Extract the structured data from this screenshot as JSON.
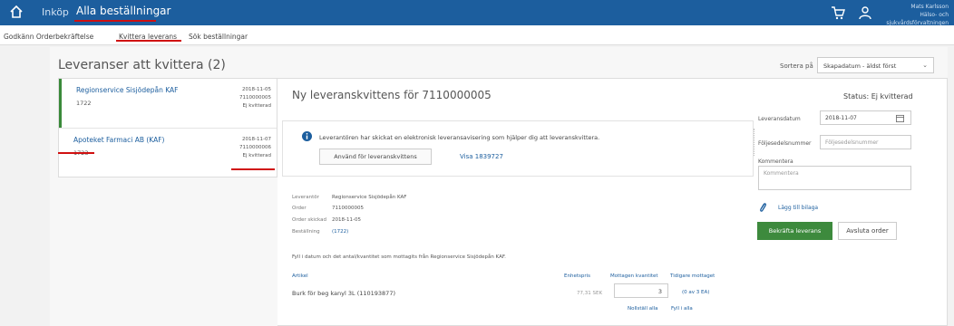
{
  "topbar": {
    "nav_inkop": "Inköp",
    "nav_alla": "Alla beställningar",
    "user_name": "Mats Karlsson",
    "user_org": "Hälso- och sjukvårdsförvaltningen",
    "home_icon": "home-icon",
    "cart_icon": "cart-icon",
    "user_icon": "user-icon",
    "bg_color": "#1c5e9e",
    "highlight_color": "#d01010"
  },
  "subnav": {
    "item1": "Godkänn Orderbekräftelse",
    "item2": "Kvittera leverans",
    "item3": "Sök beställningar"
  },
  "page": {
    "title": "Leveranser att kvittera (2)",
    "sort_label": "Sortera på",
    "sort_value": "Skapadatum - äldst först"
  },
  "deliveries": [
    {
      "name": "Regionservice Sisjödepån KAF",
      "number": "1722",
      "date": "2018-11-05",
      "order": "7110000005",
      "status": "Ej kvitterad",
      "selected": true
    },
    {
      "name": "Apoteket Farmaci AB (KAF)",
      "number": "1723",
      "date": "2018-11-07",
      "order": "7110000006",
      "status": "Ej kvitterad",
      "selected": false
    }
  ],
  "detail": {
    "title": "Ny leveranskvittens för 7110000005",
    "status": "Status: Ej kvitterad",
    "info_text": "Leverantören har skickat en elektronisk leveransavisering som hjälper dig att leveranskvittera.",
    "apply_button": "Använd för leveranskvittens",
    "visa_link": "Visa 1839727",
    "fields": {
      "leverantor_label": "Leverantör",
      "leverantor_value": "Regionservice Sisjödepån KAF",
      "order_label": "Order",
      "order_value": "7110000005",
      "skickad_label": "Order skickad",
      "skickad_value": "2018-11-05",
      "bestallning_label": "Beställning",
      "bestallning_value": "(1722)"
    },
    "instruction": "Fyll i datum och det antal/kvantitet som mottagits från Regionservice Sisjödepån KAF.",
    "table_headers": {
      "artikel": "Artikel",
      "enhetspris": "Enhetspris",
      "mottagen": "Mottagen kvantitet",
      "tidigare": "Tidigare mottaget"
    },
    "row": {
      "artikel": "Burk för beg kanyl 3L (110193877)",
      "enhetspris": "77,31 SEK",
      "mottagen": "3",
      "tidigare": "(0 av 3 EA)"
    },
    "nollstall": "Nollställ alla",
    "fyll_alla": "Fyll i alla"
  },
  "right": {
    "leveransdatum_label": "Leveransdatum",
    "leveransdatum_value": "2018-11-07",
    "foljesedel_label": "Följesedelsnummer",
    "foljesedel_placeholder": "Följesedelsnummer",
    "kommentera_label": "Kommentera",
    "kommentera_placeholder": "Kommentera",
    "bilaga": "Lägg till bilaga",
    "confirm_button": "Bekräfta leverans",
    "close_button": "Avsluta order",
    "confirm_color": "#3d8a3d"
  }
}
